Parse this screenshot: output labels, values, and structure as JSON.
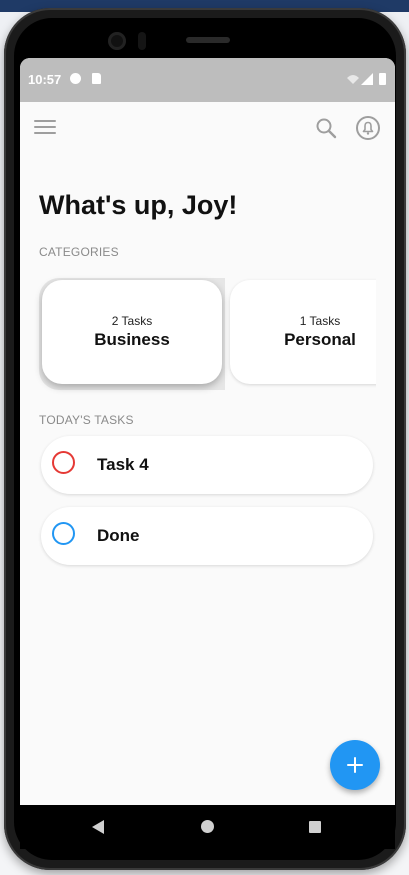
{
  "status_bar": {
    "time": "10:57"
  },
  "app_bar": {
    "menu_icon": "hamburger-menu-icon",
    "search_icon": "search-icon",
    "notifications_icon": "bell-icon"
  },
  "greeting": "What's up, Joy!",
  "categories": {
    "label": "CATEGORIES",
    "items": [
      {
        "count_label": "2 Tasks",
        "name": "Business",
        "selected": true
      },
      {
        "count_label": "1 Tasks",
        "name": "Personal",
        "selected": false
      }
    ]
  },
  "tasks": {
    "label": "TODAY'S TASKS",
    "items": [
      {
        "title": "Task 4",
        "check_color": "#e53935"
      },
      {
        "title": "Done",
        "check_color": "#2196f3"
      }
    ]
  },
  "fab": {
    "icon": "plus-icon",
    "color": "#2196f3"
  },
  "colors": {
    "status_bar": "#bdbdbd",
    "screen_background": "#fafafa",
    "text_primary": "#111111",
    "text_secondary": "#8a8a8a"
  }
}
